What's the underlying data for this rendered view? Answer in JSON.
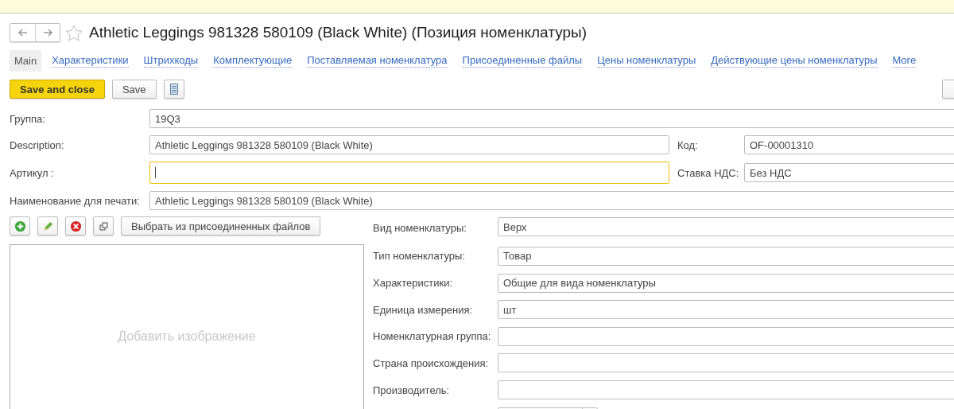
{
  "window": {
    "title": "Athletic Leggings 981328 580109 (Black White) (Позиция номенклатуры)",
    "favorite": false
  },
  "tabs": [
    {
      "label": "Main",
      "selected": true
    },
    {
      "label": "Характеристики",
      "selected": false
    },
    {
      "label": "Штрихкоды",
      "selected": false
    },
    {
      "label": "Комплектующие",
      "selected": false
    },
    {
      "label": "Поставляемая номенклатура",
      "selected": false
    },
    {
      "label": "Присоединенные файлы",
      "selected": false
    },
    {
      "label": "Цены номенклатуры",
      "selected": false
    },
    {
      "label": "Действующие цены номенклатуры",
      "selected": false
    },
    {
      "label": "More",
      "selected": false
    }
  ],
  "toolbar": {
    "buttons": [
      {
        "label": "Save and close",
        "kind": "primary"
      },
      {
        "label": "Save",
        "kind": "default"
      },
      {
        "kind": "list-icon"
      }
    ]
  },
  "header_fields": [
    {
      "label": "Группа:",
      "value": "19Q3",
      "focused": false
    },
    {
      "label": "Description:",
      "value": "Athletic Leggings 981328 580109 (Black White)",
      "focused": false
    },
    {
      "label": "Код:",
      "value": "OF-00001310",
      "focused": false
    },
    {
      "label": "Артикул :",
      "focused": true
    },
    {
      "label": "Ставка НДС:",
      "value": "Без НДС",
      "focused": false
    },
    {
      "label": "Наименование для печати:",
      "value": "Athletic Leggings 981328 580109 (Black White)",
      "focused": false
    }
  ],
  "image_panel": {
    "buttons": [
      {
        "kind": "add"
      },
      {
        "kind": "edit"
      },
      {
        "kind": "delete"
      },
      {
        "kind": "copy"
      },
      {
        "kind": "text",
        "label": "Выбрать из присоединенных файлов"
      }
    ],
    "placeholder": "Добавить изображение"
  },
  "details": [
    {
      "kind": "text",
      "label": "Вид номенклатуры:",
      "value": "Верх"
    },
    {
      "kind": "text",
      "label": "Тип номенклатуры:",
      "value": "Товар"
    },
    {
      "kind": "text",
      "label": "Характеристики:",
      "value": "Общие для вида номенклатуры"
    },
    {
      "kind": "text",
      "label": "Единица измерения:",
      "value": "шт"
    },
    {
      "kind": "text",
      "label": "Номенклатурная группа:"
    },
    {
      "kind": "text",
      "label": "Страна происхождения:"
    },
    {
      "kind": "text",
      "label": "Производитель:"
    },
    {
      "kind": "dropdown"
    }
  ]
}
